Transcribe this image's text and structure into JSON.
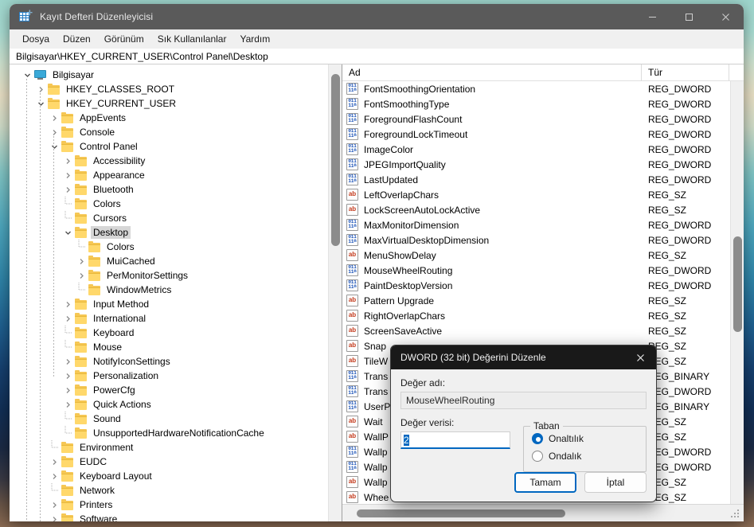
{
  "window": {
    "title": "Kayıt Defteri Düzenleyicisi",
    "app_icon": "registry-editor-icon",
    "minimize_label": "—",
    "maximize_label": "□",
    "close_label": "✕"
  },
  "menubar": {
    "items": [
      {
        "label": "Dosya"
      },
      {
        "label": "Düzen"
      },
      {
        "label": "Görünüm"
      },
      {
        "label": "Sık Kullanılanlar"
      },
      {
        "label": "Yardım"
      }
    ]
  },
  "address": {
    "path": "Bilgisayar\\HKEY_CURRENT_USER\\Control Panel\\Desktop"
  },
  "tree": {
    "nodes": [
      {
        "label": "Bilgisayar",
        "depth": 0,
        "icon": "computer-icon",
        "state": "expanded",
        "selected": false
      },
      {
        "label": "HKEY_CLASSES_ROOT",
        "depth": 1,
        "icon": "folder-icon",
        "state": "collapsed",
        "selected": false
      },
      {
        "label": "HKEY_CURRENT_USER",
        "depth": 1,
        "icon": "folder-icon",
        "state": "expanded",
        "selected": false
      },
      {
        "label": "AppEvents",
        "depth": 2,
        "icon": "folder-icon",
        "state": "collapsed",
        "selected": false
      },
      {
        "label": "Console",
        "depth": 2,
        "icon": "folder-icon",
        "state": "collapsed",
        "selected": false
      },
      {
        "label": "Control Panel",
        "depth": 2,
        "icon": "folder-icon",
        "state": "expanded",
        "selected": false
      },
      {
        "label": "Accessibility",
        "depth": 3,
        "icon": "folder-icon",
        "state": "collapsed",
        "selected": false
      },
      {
        "label": "Appearance",
        "depth": 3,
        "icon": "folder-icon",
        "state": "collapsed",
        "selected": false
      },
      {
        "label": "Bluetooth",
        "depth": 3,
        "icon": "folder-icon",
        "state": "collapsed",
        "selected": false
      },
      {
        "label": "Colors",
        "depth": 3,
        "icon": "folder-icon",
        "state": "leaf",
        "selected": false
      },
      {
        "label": "Cursors",
        "depth": 3,
        "icon": "folder-icon",
        "state": "leaf",
        "selected": false
      },
      {
        "label": "Desktop",
        "depth": 3,
        "icon": "folder-icon",
        "state": "expanded",
        "selected": true
      },
      {
        "label": "Colors",
        "depth": 4,
        "icon": "folder-icon",
        "state": "leaf",
        "selected": false
      },
      {
        "label": "MuiCached",
        "depth": 4,
        "icon": "folder-icon",
        "state": "collapsed",
        "selected": false
      },
      {
        "label": "PerMonitorSettings",
        "depth": 4,
        "icon": "folder-icon",
        "state": "collapsed",
        "selected": false
      },
      {
        "label": "WindowMetrics",
        "depth": 4,
        "icon": "folder-icon",
        "state": "leaf",
        "selected": false
      },
      {
        "label": "Input Method",
        "depth": 3,
        "icon": "folder-icon",
        "state": "collapsed",
        "selected": false
      },
      {
        "label": "International",
        "depth": 3,
        "icon": "folder-icon",
        "state": "collapsed",
        "selected": false
      },
      {
        "label": "Keyboard",
        "depth": 3,
        "icon": "folder-icon",
        "state": "leaf",
        "selected": false
      },
      {
        "label": "Mouse",
        "depth": 3,
        "icon": "folder-icon",
        "state": "leaf",
        "selected": false
      },
      {
        "label": "NotifyIconSettings",
        "depth": 3,
        "icon": "folder-icon",
        "state": "collapsed",
        "selected": false
      },
      {
        "label": "Personalization",
        "depth": 3,
        "icon": "folder-icon",
        "state": "collapsed",
        "selected": false
      },
      {
        "label": "PowerCfg",
        "depth": 3,
        "icon": "folder-icon",
        "state": "collapsed",
        "selected": false
      },
      {
        "label": "Quick Actions",
        "depth": 3,
        "icon": "folder-icon",
        "state": "collapsed",
        "selected": false
      },
      {
        "label": "Sound",
        "depth": 3,
        "icon": "folder-icon",
        "state": "leaf",
        "selected": false
      },
      {
        "label": "UnsupportedHardwareNotificationCache",
        "depth": 3,
        "icon": "folder-icon",
        "state": "leaf",
        "selected": false
      },
      {
        "label": "Environment",
        "depth": 2,
        "icon": "folder-icon",
        "state": "leaf",
        "selected": false
      },
      {
        "label": "EUDC",
        "depth": 2,
        "icon": "folder-icon",
        "state": "collapsed",
        "selected": false
      },
      {
        "label": "Keyboard Layout",
        "depth": 2,
        "icon": "folder-icon",
        "state": "collapsed",
        "selected": false
      },
      {
        "label": "Network",
        "depth": 2,
        "icon": "folder-icon",
        "state": "leaf",
        "selected": false
      },
      {
        "label": "Printers",
        "depth": 2,
        "icon": "folder-icon",
        "state": "collapsed",
        "selected": false
      },
      {
        "label": "Software",
        "depth": 2,
        "icon": "folder-icon",
        "state": "collapsed",
        "selected": false
      }
    ]
  },
  "list": {
    "columns": [
      {
        "label": "Ad"
      },
      {
        "label": "Tür"
      }
    ],
    "rows": [
      {
        "name": "FontSmoothingOrientation",
        "type": "REG_DWORD",
        "icon": "dword-value-icon"
      },
      {
        "name": "FontSmoothingType",
        "type": "REG_DWORD",
        "icon": "dword-value-icon"
      },
      {
        "name": "ForegroundFlashCount",
        "type": "REG_DWORD",
        "icon": "dword-value-icon"
      },
      {
        "name": "ForegroundLockTimeout",
        "type": "REG_DWORD",
        "icon": "dword-value-icon"
      },
      {
        "name": "ImageColor",
        "type": "REG_DWORD",
        "icon": "dword-value-icon"
      },
      {
        "name": "JPEGImportQuality",
        "type": "REG_DWORD",
        "icon": "dword-value-icon"
      },
      {
        "name": "LastUpdated",
        "type": "REG_DWORD",
        "icon": "dword-value-icon"
      },
      {
        "name": "LeftOverlapChars",
        "type": "REG_SZ",
        "icon": "string-value-icon"
      },
      {
        "name": "LockScreenAutoLockActive",
        "type": "REG_SZ",
        "icon": "string-value-icon"
      },
      {
        "name": "MaxMonitorDimension",
        "type": "REG_DWORD",
        "icon": "dword-value-icon"
      },
      {
        "name": "MaxVirtualDesktopDimension",
        "type": "REG_DWORD",
        "icon": "dword-value-icon"
      },
      {
        "name": "MenuShowDelay",
        "type": "REG_SZ",
        "icon": "string-value-icon"
      },
      {
        "name": "MouseWheelRouting",
        "type": "REG_DWORD",
        "icon": "dword-value-icon"
      },
      {
        "name": "PaintDesktopVersion",
        "type": "REG_DWORD",
        "icon": "dword-value-icon"
      },
      {
        "name": "Pattern Upgrade",
        "type": "REG_SZ",
        "icon": "string-value-icon"
      },
      {
        "name": "RightOverlapChars",
        "type": "REG_SZ",
        "icon": "string-value-icon"
      },
      {
        "name": "ScreenSaveActive",
        "type": "REG_SZ",
        "icon": "string-value-icon"
      },
      {
        "name": "Snap",
        "type": "REG_SZ",
        "icon": "string-value-icon"
      },
      {
        "name": "TileW",
        "type": "REG_SZ",
        "icon": "string-value-icon"
      },
      {
        "name": "Trans",
        "type": "REG_BINARY",
        "icon": "dword-value-icon"
      },
      {
        "name": "Trans",
        "type": "REG_DWORD",
        "icon": "dword-value-icon"
      },
      {
        "name": "UserP",
        "type": "REG_BINARY",
        "icon": "dword-value-icon"
      },
      {
        "name": "Wait",
        "type": "REG_SZ",
        "icon": "string-value-icon"
      },
      {
        "name": "WallP",
        "type": "REG_SZ",
        "icon": "string-value-icon"
      },
      {
        "name": "Wallp",
        "type": "REG_DWORD",
        "icon": "dword-value-icon"
      },
      {
        "name": "Wallp",
        "type": "REG_DWORD",
        "icon": "dword-value-icon"
      },
      {
        "name": "Wallp",
        "type": "REG_SZ",
        "icon": "string-value-icon"
      },
      {
        "name": "Whee",
        "type": "REG_SZ",
        "icon": "string-value-icon"
      }
    ]
  },
  "dialog": {
    "title": "DWORD (32 bit) Değerini Düzenle",
    "close_label": "✕",
    "name_label": "Değer adı:",
    "name_value": "MouseWheelRouting",
    "data_label": "Değer verisi:",
    "data_value": "2",
    "base_legend": "Taban",
    "base_options": [
      {
        "label": "Onaltılık",
        "selected": true
      },
      {
        "label": "Ondalık",
        "selected": false
      }
    ],
    "ok_label": "Tamam",
    "cancel_label": "İptal"
  },
  "colors": {
    "accent": "#0067c0",
    "titlebar": "#5a5a5a",
    "dialog_titlebar": "#191919",
    "dword_icon": "#1a52b8",
    "string_icon": "#c43a1c",
    "folder": "#f6c754"
  }
}
